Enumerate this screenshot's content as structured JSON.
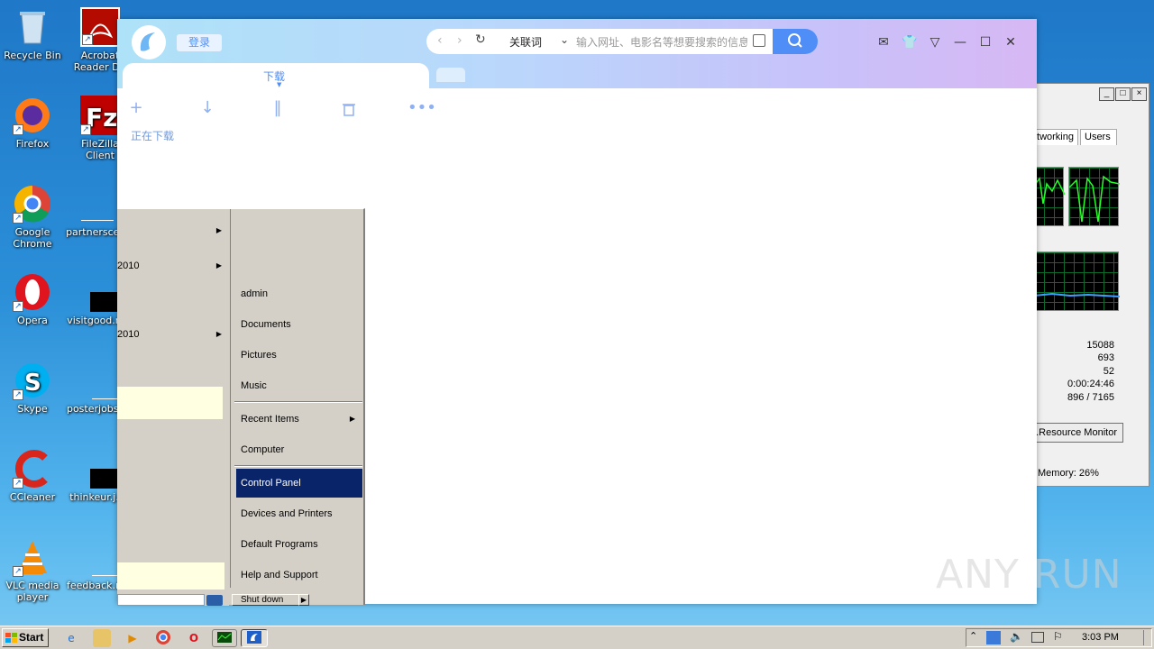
{
  "desktop": {
    "icons": [
      {
        "label": "Recycle Bin",
        "icon": "recycle-bin-icon"
      },
      {
        "label": "Acrobat Reader DC",
        "icon": "acrobat-icon"
      },
      {
        "label": "Firefox",
        "icon": "firefox-icon"
      },
      {
        "label": "FileZilla Client",
        "icon": "filezilla-icon"
      },
      {
        "label": "Google Chrome",
        "icon": "chrome-icon"
      },
      {
        "label": "partnersce...",
        "icon": "file-icon"
      },
      {
        "label": "Opera",
        "icon": "opera-icon"
      },
      {
        "label": "visitgood.r...",
        "icon": "file-icon"
      },
      {
        "label": "Skype",
        "icon": "skype-icon"
      },
      {
        "label": "posterjobs...",
        "icon": "file-icon"
      },
      {
        "label": "CCleaner",
        "icon": "ccleaner-icon"
      },
      {
        "label": "thinkeur.j...",
        "icon": "file-icon"
      },
      {
        "label": "VLC media player",
        "icon": "vlc-icon"
      },
      {
        "label": "feedback.r...",
        "icon": "file-icon"
      }
    ]
  },
  "browser": {
    "login_label": "登录",
    "keyword_dropdown": "关联词",
    "address_placeholder": "输入网址、电影名等想要搜索的信息",
    "tab_title": "下载",
    "toolbar_status": "正在下载"
  },
  "taskmgr": {
    "tabs": [
      "Networking",
      "Users"
    ],
    "values": [
      "15088",
      "693",
      "52",
      "0:00:24:46",
      "896 / 7165"
    ],
    "resource_monitor_label": "Resource Monitor...",
    "status_memory": "Memory: 26%"
  },
  "start_menu": {
    "left_items": [
      "",
      "2010",
      "",
      "2010"
    ],
    "right_items": [
      "admin",
      "Documents",
      "Pictures",
      "Music",
      "Recent Items",
      "Computer",
      "Control Panel",
      "Devices and Printers",
      "Default Programs",
      "Help and Support"
    ],
    "selected": "Control Panel",
    "search_value": "",
    "shutdown_label": "Shut down"
  },
  "taskbar": {
    "start_label": "Start",
    "clock": "3:03 PM"
  },
  "watermark": "ANY RUN",
  "colors": {
    "selected_bg": "#0a246a",
    "browser_accent": "#4f8ef7",
    "taskbar_bg": "#d4d0c8"
  }
}
